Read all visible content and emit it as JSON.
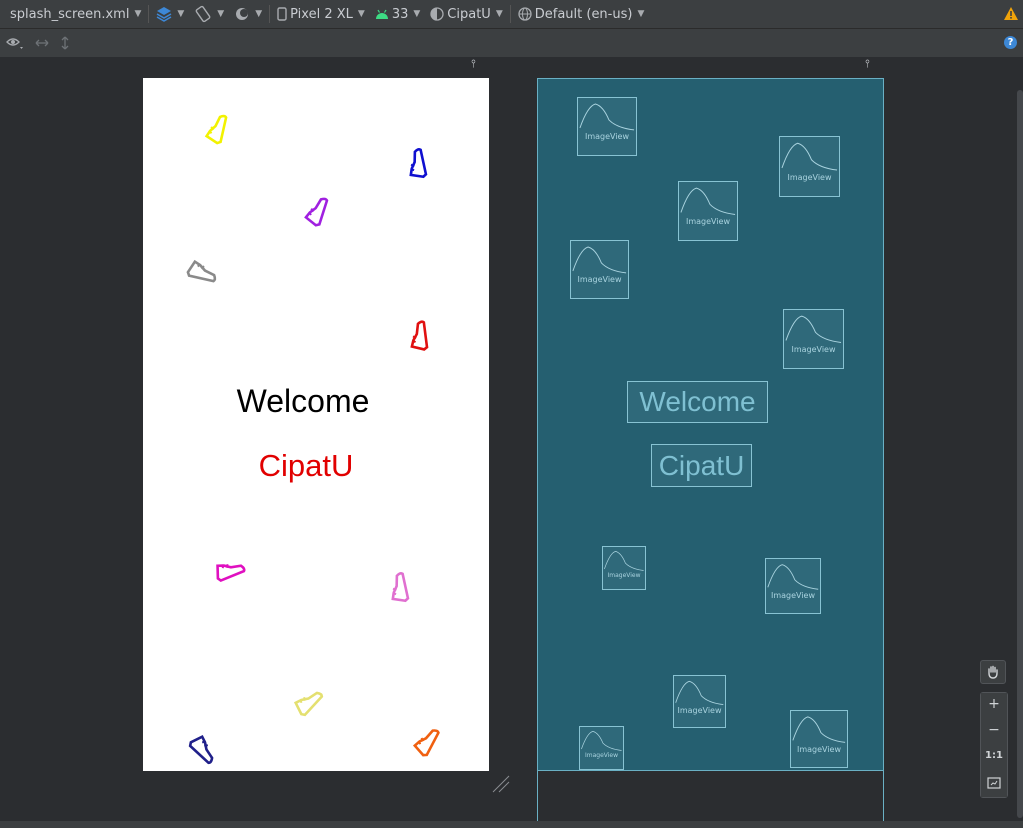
{
  "toolbar": {
    "file": "splash_screen.xml",
    "device": "Pixel 2 XL",
    "api": "33",
    "theme": "CipatU",
    "locale": "Default (en-us)"
  },
  "design": {
    "welcome": "Welcome",
    "brand": "CipatU"
  },
  "blueprint": {
    "welcome": "Welcome",
    "brand": "CipatU",
    "imageview_label": "ImageView"
  },
  "zoom": {
    "plus": "+",
    "minus": "−",
    "one_to_one": "1:1"
  },
  "colors": {
    "accent_warning": "#f0a30a",
    "blueprint_bg": "#255f70",
    "brand_text": "#e10000"
  }
}
